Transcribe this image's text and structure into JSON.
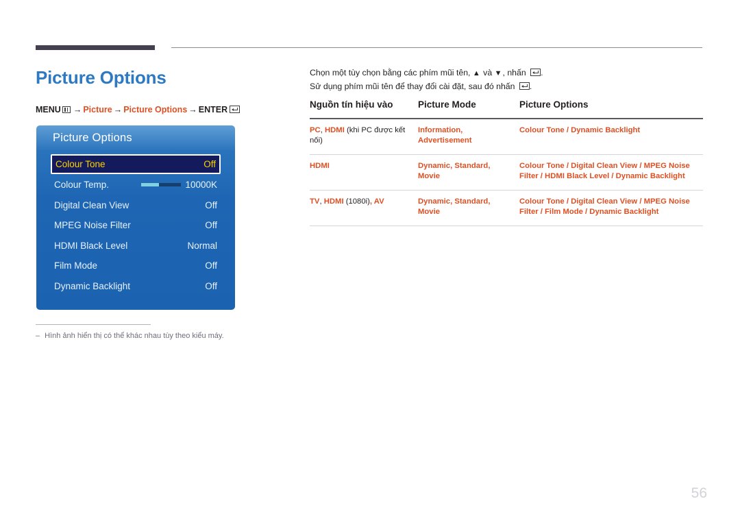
{
  "page": {
    "title": "Picture Options",
    "number": "56"
  },
  "breadcrumb": {
    "menu_label": "MENU",
    "menu_icon": "menu-grid-icon",
    "arrow": "→",
    "crumb1": "Picture",
    "crumb2": "Picture Options",
    "enter_label": "ENTER",
    "enter_icon": "enter-key-icon"
  },
  "osd": {
    "title": "Picture Options",
    "rows": [
      {
        "label": "Colour Tone",
        "value": "Off",
        "selected": true,
        "slider": false
      },
      {
        "label": "Colour Temp.",
        "value": "10000K",
        "selected": false,
        "slider": true
      },
      {
        "label": "Digital Clean View",
        "value": "Off",
        "selected": false,
        "slider": false
      },
      {
        "label": "MPEG Noise Filter",
        "value": "Off",
        "selected": false,
        "slider": false
      },
      {
        "label": "HDMI Black Level",
        "value": "Normal",
        "selected": false,
        "slider": false
      },
      {
        "label": "Film Mode",
        "value": "Off",
        "selected": false,
        "slider": false
      },
      {
        "label": "Dynamic Backlight",
        "value": "Off",
        "selected": false,
        "slider": false
      }
    ]
  },
  "footnote": {
    "dash": "‒",
    "text": "Hình ảnh hiển thị có thể khác nhau tùy theo kiểu máy."
  },
  "intro": {
    "line1_a": "Chọn một tùy chọn bằng các phím mũi tên, ",
    "line1_up": "▲",
    "line1_b": " và ",
    "line1_down": "▼",
    "line1_c": ", nhấn ",
    "line1_d": ".",
    "line2_a": "Sử dụng phím mũi tên để thay đổi cài đặt, sau đó nhấn ",
    "line2_b": "."
  },
  "table": {
    "headers": [
      "Nguồn tín hiệu vào",
      "Picture Mode",
      "Picture Options"
    ],
    "rows": [
      {
        "source_a": "PC",
        "source_sep1": ", ",
        "source_b": "HDMI",
        "source_note": " (khi PC được kết nối)",
        "source_c": "",
        "mode": "Information, Advertisement",
        "options": "Colour Tone / Dynamic Backlight"
      },
      {
        "source_a": "HDMI",
        "source_sep1": "",
        "source_b": "",
        "source_note": "",
        "source_c": "",
        "mode": "Dynamic, Standard, Movie",
        "options": "Colour Tone / Digital Clean View / MPEG Noise Filter / HDMI Black Level / Dynamic Backlight"
      },
      {
        "source_a": "TV",
        "source_sep1": ", ",
        "source_b": "HDMI",
        "source_note": " (1080i)",
        "source_c": ", AV",
        "mode": "Dynamic, Standard, Movie",
        "options": "Colour Tone / Digital Clean View / MPEG Noise Filter / Film Mode / Dynamic Backlight"
      }
    ]
  },
  "colors": {
    "accent_orange": "#dd5023",
    "title_blue": "#2e7ac2",
    "osd_blue": "#1e66b3",
    "osd_selected_bg": "#131b5c",
    "osd_selected_text": "#ffd200",
    "rule_dark": "#45404f"
  }
}
